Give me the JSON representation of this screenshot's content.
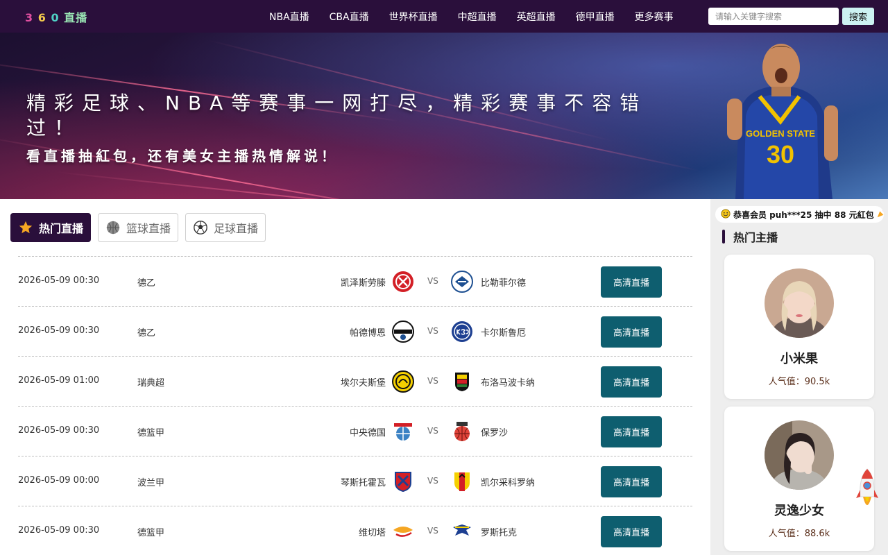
{
  "header": {
    "logo_parts": [
      "3",
      "6",
      "0",
      "直播"
    ],
    "nav": [
      "NBA直播",
      "CBA直播",
      "世界杯直播",
      "中超直播",
      "英超直播",
      "德甲直播",
      "更多赛事"
    ],
    "search_placeholder": "请输入关键字搜索",
    "search_button": "搜索"
  },
  "banner": {
    "title": "精彩足球、NBA等赛事一网打尽，精彩赛事不容错过！",
    "subtitle": "看直播抽紅包，还有美女主播热情解说！"
  },
  "tabs": [
    {
      "label": "热门直播",
      "icon": "star-icon",
      "active": true
    },
    {
      "label": "篮球直播",
      "icon": "basketball-icon",
      "active": false
    },
    {
      "label": "足球直播",
      "icon": "soccer-ball-icon",
      "active": false
    }
  ],
  "matches": [
    {
      "time": "2026-05-09 00:30",
      "league": "德乙",
      "home": "凯泽斯劳滕",
      "vs": "VS",
      "away": "比勒菲尔德",
      "button": "高清直播"
    },
    {
      "time": "2026-05-09 00:30",
      "league": "德乙",
      "home": "帕德博恩",
      "vs": "VS",
      "away": "卡尔斯鲁厄",
      "button": "高清直播"
    },
    {
      "time": "2026-05-09 01:00",
      "league": "瑞典超",
      "home": "埃尔夫斯堡",
      "vs": "VS",
      "away": "布洛马波卡纳",
      "button": "高清直播"
    },
    {
      "time": "2026-05-09 00:30",
      "league": "德篮甲",
      "home": "中央德国",
      "vs": "VS",
      "away": "保罗沙",
      "button": "高清直播"
    },
    {
      "time": "2026-05-09 00:00",
      "league": "波兰甲",
      "home": "琴斯托霍瓦",
      "vs": "VS",
      "away": "凯尔采科罗纳",
      "button": "高清直播"
    },
    {
      "time": "2026-05-09 00:30",
      "league": "德篮甲",
      "home": "维切塔",
      "vs": "VS",
      "away": "罗斯托克",
      "button": "高清直播"
    }
  ],
  "sidebar": {
    "marquee": "恭喜会员 puh***25 抽中 88 元紅包",
    "title": "热门主播",
    "anchors": [
      {
        "name": "小米果",
        "popularity": "人气值：90.5k"
      },
      {
        "name": "灵逸少女",
        "popularity": "人气值：88.6k"
      }
    ]
  },
  "colors": {
    "header_bg": "#2a0f3b",
    "button_teal": "#0e5e6f",
    "search_btn_bg": "#ccf2f2"
  }
}
